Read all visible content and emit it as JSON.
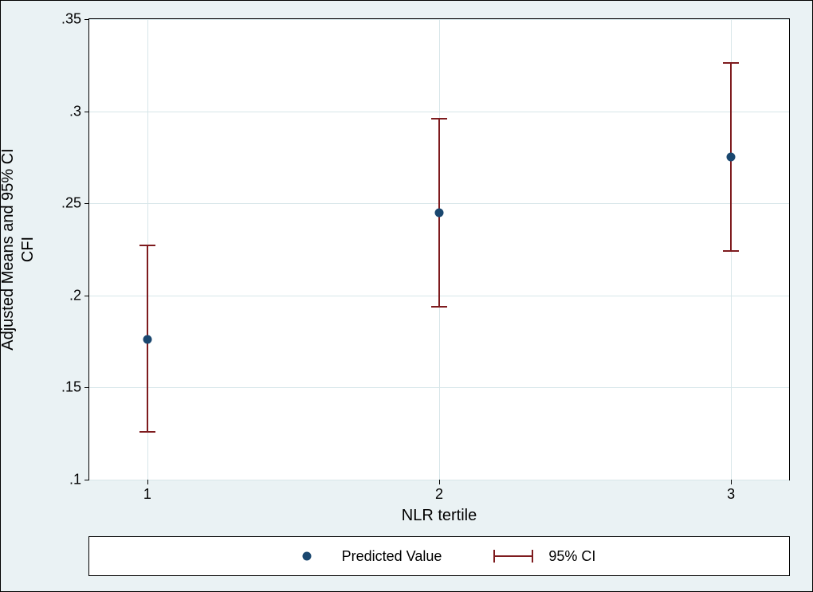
{
  "chart_data": {
    "type": "scatter",
    "xlabel": "NLR tertile",
    "ylabel": "Adjusted Means and 95% CI\nCFI",
    "ylim": [
      0.1,
      0.35
    ],
    "yticks": [
      0.1,
      0.15,
      0.2,
      0.25,
      0.3,
      0.35
    ],
    "ytick_labels": [
      ".1",
      ".15",
      ".2",
      ".25",
      ".3",
      ".35"
    ],
    "categories": [
      "1",
      "2",
      "3"
    ],
    "series": [
      {
        "name": "Predicted Value",
        "values": [
          0.176,
          0.245,
          0.275
        ],
        "ci_low": [
          0.126,
          0.194,
          0.224
        ],
        "ci_high": [
          0.227,
          0.296,
          0.326
        ]
      }
    ],
    "legend_ci_label": "95% CI"
  }
}
